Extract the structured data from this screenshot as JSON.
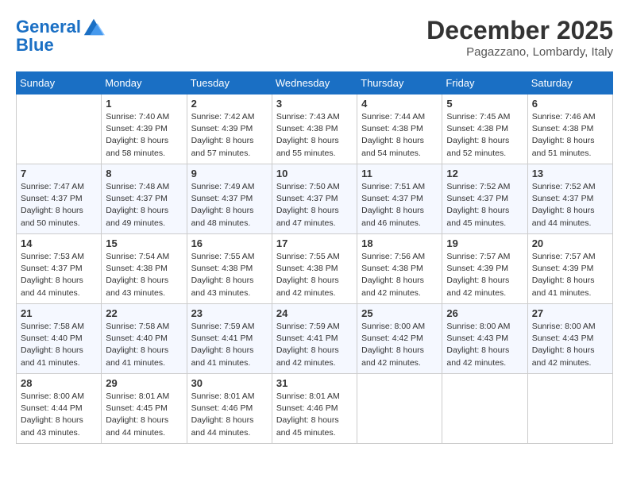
{
  "header": {
    "logo_line1": "General",
    "logo_line2": "Blue",
    "month": "December 2025",
    "location": "Pagazzano, Lombardy, Italy"
  },
  "weekdays": [
    "Sunday",
    "Monday",
    "Tuesday",
    "Wednesday",
    "Thursday",
    "Friday",
    "Saturday"
  ],
  "weeks": [
    [
      {
        "day": "",
        "sunrise": "",
        "sunset": "",
        "daylight": ""
      },
      {
        "day": "1",
        "sunrise": "Sunrise: 7:40 AM",
        "sunset": "Sunset: 4:39 PM",
        "daylight": "Daylight: 8 hours and 58 minutes."
      },
      {
        "day": "2",
        "sunrise": "Sunrise: 7:42 AM",
        "sunset": "Sunset: 4:39 PM",
        "daylight": "Daylight: 8 hours and 57 minutes."
      },
      {
        "day": "3",
        "sunrise": "Sunrise: 7:43 AM",
        "sunset": "Sunset: 4:38 PM",
        "daylight": "Daylight: 8 hours and 55 minutes."
      },
      {
        "day": "4",
        "sunrise": "Sunrise: 7:44 AM",
        "sunset": "Sunset: 4:38 PM",
        "daylight": "Daylight: 8 hours and 54 minutes."
      },
      {
        "day": "5",
        "sunrise": "Sunrise: 7:45 AM",
        "sunset": "Sunset: 4:38 PM",
        "daylight": "Daylight: 8 hours and 52 minutes."
      },
      {
        "day": "6",
        "sunrise": "Sunrise: 7:46 AM",
        "sunset": "Sunset: 4:38 PM",
        "daylight": "Daylight: 8 hours and 51 minutes."
      }
    ],
    [
      {
        "day": "7",
        "sunrise": "Sunrise: 7:47 AM",
        "sunset": "Sunset: 4:37 PM",
        "daylight": "Daylight: 8 hours and 50 minutes."
      },
      {
        "day": "8",
        "sunrise": "Sunrise: 7:48 AM",
        "sunset": "Sunset: 4:37 PM",
        "daylight": "Daylight: 8 hours and 49 minutes."
      },
      {
        "day": "9",
        "sunrise": "Sunrise: 7:49 AM",
        "sunset": "Sunset: 4:37 PM",
        "daylight": "Daylight: 8 hours and 48 minutes."
      },
      {
        "day": "10",
        "sunrise": "Sunrise: 7:50 AM",
        "sunset": "Sunset: 4:37 PM",
        "daylight": "Daylight: 8 hours and 47 minutes."
      },
      {
        "day": "11",
        "sunrise": "Sunrise: 7:51 AM",
        "sunset": "Sunset: 4:37 PM",
        "daylight": "Daylight: 8 hours and 46 minutes."
      },
      {
        "day": "12",
        "sunrise": "Sunrise: 7:52 AM",
        "sunset": "Sunset: 4:37 PM",
        "daylight": "Daylight: 8 hours and 45 minutes."
      },
      {
        "day": "13",
        "sunrise": "Sunrise: 7:52 AM",
        "sunset": "Sunset: 4:37 PM",
        "daylight": "Daylight: 8 hours and 44 minutes."
      }
    ],
    [
      {
        "day": "14",
        "sunrise": "Sunrise: 7:53 AM",
        "sunset": "Sunset: 4:37 PM",
        "daylight": "Daylight: 8 hours and 44 minutes."
      },
      {
        "day": "15",
        "sunrise": "Sunrise: 7:54 AM",
        "sunset": "Sunset: 4:38 PM",
        "daylight": "Daylight: 8 hours and 43 minutes."
      },
      {
        "day": "16",
        "sunrise": "Sunrise: 7:55 AM",
        "sunset": "Sunset: 4:38 PM",
        "daylight": "Daylight: 8 hours and 43 minutes."
      },
      {
        "day": "17",
        "sunrise": "Sunrise: 7:55 AM",
        "sunset": "Sunset: 4:38 PM",
        "daylight": "Daylight: 8 hours and 42 minutes."
      },
      {
        "day": "18",
        "sunrise": "Sunrise: 7:56 AM",
        "sunset": "Sunset: 4:38 PM",
        "daylight": "Daylight: 8 hours and 42 minutes."
      },
      {
        "day": "19",
        "sunrise": "Sunrise: 7:57 AM",
        "sunset": "Sunset: 4:39 PM",
        "daylight": "Daylight: 8 hours and 42 minutes."
      },
      {
        "day": "20",
        "sunrise": "Sunrise: 7:57 AM",
        "sunset": "Sunset: 4:39 PM",
        "daylight": "Daylight: 8 hours and 41 minutes."
      }
    ],
    [
      {
        "day": "21",
        "sunrise": "Sunrise: 7:58 AM",
        "sunset": "Sunset: 4:40 PM",
        "daylight": "Daylight: 8 hours and 41 minutes."
      },
      {
        "day": "22",
        "sunrise": "Sunrise: 7:58 AM",
        "sunset": "Sunset: 4:40 PM",
        "daylight": "Daylight: 8 hours and 41 minutes."
      },
      {
        "day": "23",
        "sunrise": "Sunrise: 7:59 AM",
        "sunset": "Sunset: 4:41 PM",
        "daylight": "Daylight: 8 hours and 41 minutes."
      },
      {
        "day": "24",
        "sunrise": "Sunrise: 7:59 AM",
        "sunset": "Sunset: 4:41 PM",
        "daylight": "Daylight: 8 hours and 42 minutes."
      },
      {
        "day": "25",
        "sunrise": "Sunrise: 8:00 AM",
        "sunset": "Sunset: 4:42 PM",
        "daylight": "Daylight: 8 hours and 42 minutes."
      },
      {
        "day": "26",
        "sunrise": "Sunrise: 8:00 AM",
        "sunset": "Sunset: 4:43 PM",
        "daylight": "Daylight: 8 hours and 42 minutes."
      },
      {
        "day": "27",
        "sunrise": "Sunrise: 8:00 AM",
        "sunset": "Sunset: 4:43 PM",
        "daylight": "Daylight: 8 hours and 42 minutes."
      }
    ],
    [
      {
        "day": "28",
        "sunrise": "Sunrise: 8:00 AM",
        "sunset": "Sunset: 4:44 PM",
        "daylight": "Daylight: 8 hours and 43 minutes."
      },
      {
        "day": "29",
        "sunrise": "Sunrise: 8:01 AM",
        "sunset": "Sunset: 4:45 PM",
        "daylight": "Daylight: 8 hours and 44 minutes."
      },
      {
        "day": "30",
        "sunrise": "Sunrise: 8:01 AM",
        "sunset": "Sunset: 4:46 PM",
        "daylight": "Daylight: 8 hours and 44 minutes."
      },
      {
        "day": "31",
        "sunrise": "Sunrise: 8:01 AM",
        "sunset": "Sunset: 4:46 PM",
        "daylight": "Daylight: 8 hours and 45 minutes."
      },
      {
        "day": "",
        "sunrise": "",
        "sunset": "",
        "daylight": ""
      },
      {
        "day": "",
        "sunrise": "",
        "sunset": "",
        "daylight": ""
      },
      {
        "day": "",
        "sunrise": "",
        "sunset": "",
        "daylight": ""
      }
    ]
  ]
}
